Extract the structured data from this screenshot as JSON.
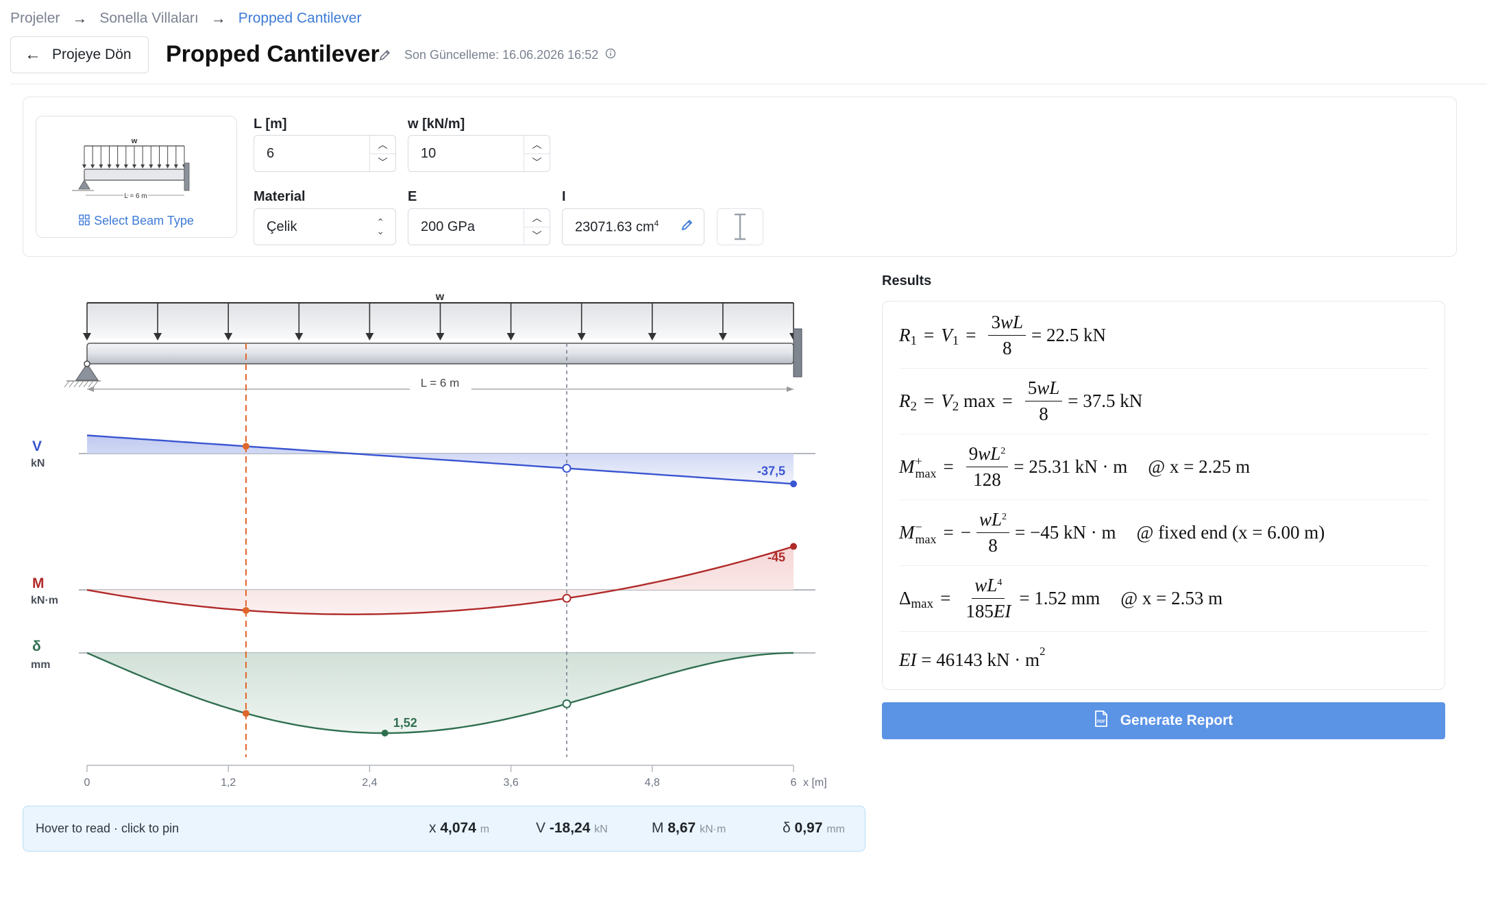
{
  "breadcrumb": {
    "item1": "Projeler",
    "item2": "Sonella Villaları",
    "item3": "Propped Cantilever",
    "sep": "→"
  },
  "header": {
    "back_label": "Projeye Dön",
    "title": "Propped Cantilever",
    "updated": "Son Güncelleme: 16.06.2026 16:52"
  },
  "beam_type": {
    "load_label": "w",
    "span_label": "L = 6 m",
    "select_label": "Select Beam Type"
  },
  "inputs": {
    "L": {
      "label": "L [m]",
      "value": "6"
    },
    "w": {
      "label": "w [kN/m]",
      "value": "10"
    },
    "material": {
      "label": "Material",
      "value": "Çelik"
    },
    "E": {
      "label": "E",
      "value": "200 GPa"
    },
    "I": {
      "label": "I",
      "value": "23071.63 cm",
      "unit_sup": "4"
    }
  },
  "diagram": {
    "load_label": "w",
    "span_label": "L = 6 m",
    "V": {
      "name": "V",
      "unit": "kN",
      "end_label": "-37,5",
      "color": "#3a55d1"
    },
    "M": {
      "name": "M",
      "unit": "kN·m",
      "end_label": "-45",
      "color": "#b02a2a"
    },
    "D": {
      "name": "δ",
      "unit": "mm",
      "peak_label": "1,52",
      "color": "#2f6f50"
    },
    "x_ticks": [
      "0",
      "1,2",
      "2,4",
      "3,6",
      "4,8",
      "6"
    ],
    "x_unit": "x [m]",
    "hover_x": 4.074,
    "pinned_x": 1.35
  },
  "readout": {
    "hint": "Hover to read · click to pin",
    "x_label": "x",
    "x_value": "4,074",
    "x_unit": "m",
    "V_label": "V",
    "V_value": "-18,24",
    "V_unit": "kN",
    "M_label": "M",
    "M_value": "8,67",
    "M_unit": "kN·m",
    "d_label": "δ",
    "d_value": "0,97",
    "d_unit": "mm"
  },
  "results": {
    "title": "Results",
    "r1_value": "= 22.5 kN",
    "r2_value": "= 37.5 kN",
    "mpos_value": "= 25.31 kN · m",
    "mpos_at": "@ x = 2.25 m",
    "mneg_value": "= −45 kN · m",
    "mneg_at": "@ fixed end (x = 6.00 m)",
    "dmax_value": "= 1.52 mm",
    "dmax_at": "@ x = 2.53 m",
    "ei_value": "= 46143 kN · m",
    "ei_sup": "2"
  },
  "generate_label": "Generate Report",
  "colors": {
    "accent": "#3d7bd6",
    "button": "#5b93e5"
  }
}
